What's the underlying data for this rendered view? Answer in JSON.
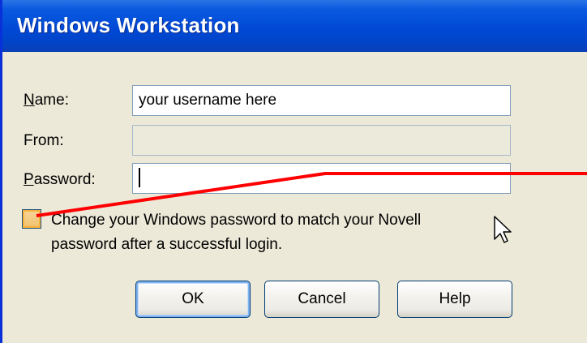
{
  "window": {
    "title": "Windows Workstation"
  },
  "form": {
    "name_label_accel": "N",
    "name_label_rest": "ame:",
    "name_value": "your username here",
    "from_label": "From:",
    "from_value": "",
    "password_label_accel": "P",
    "password_label_rest": "assword:",
    "password_value": ""
  },
  "checkbox": {
    "checked": false,
    "label": "Change your Windows password to match your Novell password after a successful login."
  },
  "buttons": {
    "ok": "OK",
    "cancel": "Cancel",
    "help": "Help"
  },
  "colors": {
    "titlebar": "#0049d6",
    "dialog_bg": "#ece9d8",
    "annotation_line": "#ff0000"
  }
}
